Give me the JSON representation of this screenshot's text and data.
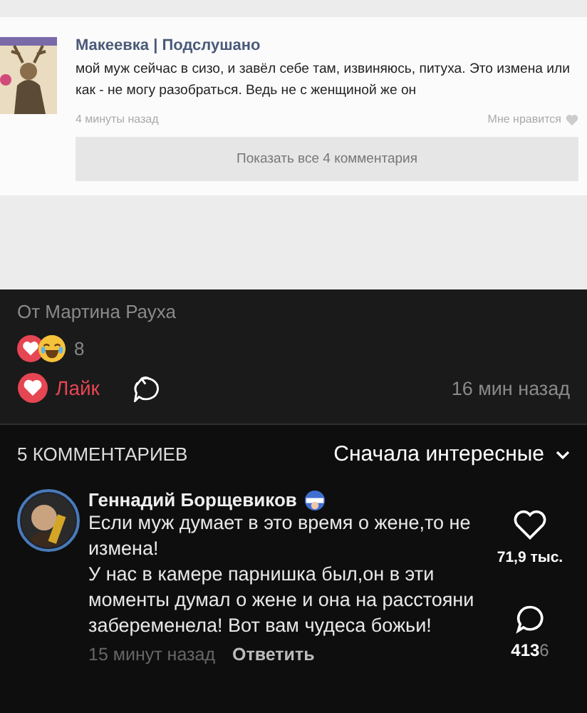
{
  "post_image": {
    "group": "Макеевка | Подслушано",
    "text": "мой муж сейчас в сизо, и завёл себе там, извиняюсь, питуха. Это измена или как - не могу разобраться. Ведь не с женщиной же он",
    "time": "4 минуты назад",
    "like": "Мне нравится",
    "show_all": "Показать все 4 комментария"
  },
  "post": {
    "author": "От Мартина Рауха",
    "reactions_count": "8",
    "like_label": "Лайк",
    "liked": true,
    "time": "16 мин назад"
  },
  "comments_header": {
    "count": "5 КОММЕНТАРИЕВ",
    "sort": "Сначала интересные"
  },
  "comments": [
    {
      "author": "Геннадий Борщевиков",
      "paragraphs": [
        "Если муж думает в это время о жене,то не измена!",
        "У нас в камере парнишка был,он в эти моменты думал о жене и она на расстояни забеременела! Вот вам чудеса божьи!"
      ],
      "time": "15 минут назад",
      "reply": "Ответить",
      "likes": "71,9 тыс.",
      "replies": "413",
      "extra": "6"
    }
  ]
}
